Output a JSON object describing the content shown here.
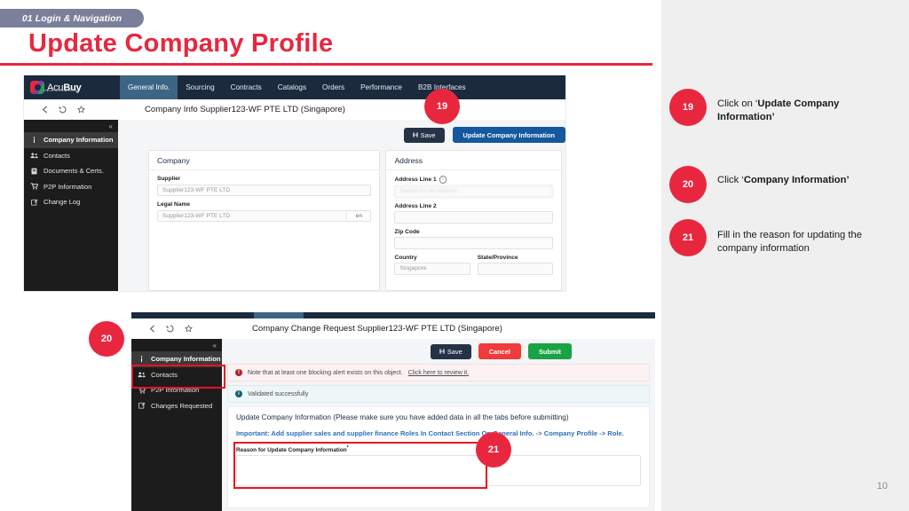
{
  "slide": {
    "kicker": "01 Login & Navigation",
    "title": "Update Company Profile",
    "page_number": "10",
    "accent_color": "#e8273f",
    "kicker_bg": "#7c7f9a"
  },
  "screenshot_top": {
    "app": {
      "logo_text_light": "Acu",
      "logo_text_bold": "Buy",
      "logo_subtext": "beyond sourcing savings",
      "nav_tabs": [
        {
          "label": "General Info.",
          "active": true
        },
        {
          "label": "Sourcing",
          "active": false
        },
        {
          "label": "Contracts",
          "active": false
        },
        {
          "label": "Catalogs",
          "active": false
        },
        {
          "label": "Orders",
          "active": false
        },
        {
          "label": "Performance",
          "active": false
        },
        {
          "label": "B2B Interfaces",
          "active": false
        }
      ]
    },
    "breadcrumb_title": "Company Info Supplier123-WF PTE LTD (Singapore)",
    "breadcrumb_icons": [
      "back-arrow-icon",
      "history-icon",
      "star-icon"
    ],
    "sidenav": [
      {
        "label": "Company Information",
        "icon": "info-icon",
        "active": true
      },
      {
        "label": "Contacts",
        "icon": "contacts-icon",
        "active": false
      },
      {
        "label": "Documents & Certs.",
        "icon": "document-icon",
        "active": false
      },
      {
        "label": "P2P Information",
        "icon": "cart-icon",
        "active": false
      },
      {
        "label": "Change Log",
        "icon": "edit-icon",
        "active": false
      }
    ],
    "buttons": {
      "save": "Save",
      "update": "Update Company Information",
      "save_color": "#253247",
      "update_color": "#14589e"
    },
    "company_card": {
      "header": "Company",
      "fields": [
        {
          "label": "Supplier",
          "value": "Supplier123-WF PTE LTD",
          "suffix": ""
        },
        {
          "label": "Legal Name",
          "value": "Supplier123-WF PTE LTD",
          "suffix": "en"
        }
      ]
    },
    "address_card": {
      "header": "Address",
      "address_line_1_label": "Address Line 1",
      "address_line_1_placeholder": "Search for an address...",
      "address_line_2_label": "Address Line 2",
      "address_line_2_value": "",
      "zip_label": "Zip Code",
      "zip_value": "",
      "country_label": "Country",
      "country_value": "Singapore",
      "state_label": "State/Province",
      "state_value": ""
    }
  },
  "screenshot_bottom": {
    "breadcrumb_title": "Company Change Request Supplier123-WF PTE LTD (Singapore)",
    "sidenav": [
      {
        "label": "Company Information",
        "icon": "info-icon",
        "active": true
      },
      {
        "label": "Contacts",
        "icon": "contacts-icon",
        "active": false
      },
      {
        "label": "P2P Information",
        "icon": "cart-icon",
        "active": false
      },
      {
        "label": "Changes Requested",
        "icon": "edit-icon",
        "active": false
      }
    ],
    "buttons": {
      "save": "Save",
      "cancel": "Cancel",
      "submit": "Submit",
      "save_color": "#253247",
      "cancel_color": "#ef3b3b",
      "submit_color": "#19a344"
    },
    "alerts": [
      {
        "type": "error",
        "text": "Note that at least one blocking alert exists on this object.",
        "link": "Click here to review it."
      },
      {
        "type": "info",
        "text": "Validated successfully",
        "link": ""
      }
    ],
    "panel": {
      "title": "Update Company Information (Please make sure you have added data in all the tabs before submitting)",
      "note": "Important: Add supplier sales and supplier finance Roles In Contact Section On General Info. -> Company Profile -> Role.",
      "textarea_label": "Reason for Update Company Information",
      "textarea_required_mark": "*",
      "textarea_value": ""
    }
  },
  "annotations": [
    {
      "number": "19",
      "prefix": "Click on ",
      "quote_open": "‘",
      "emphasis": "Update Company Information",
      "quote_close": "’",
      "suffix": ""
    },
    {
      "number": "20",
      "prefix": "Click ",
      "quote_open": "‘",
      "emphasis": "Company Information",
      "quote_close": "’",
      "suffix": ""
    },
    {
      "number": "21",
      "prefix": "Fill in the reason for updating the company information",
      "quote_open": "",
      "emphasis": "",
      "quote_close": "",
      "suffix": ""
    }
  ],
  "badges": {
    "b19": "19",
    "b20": "20",
    "b21": "21"
  }
}
